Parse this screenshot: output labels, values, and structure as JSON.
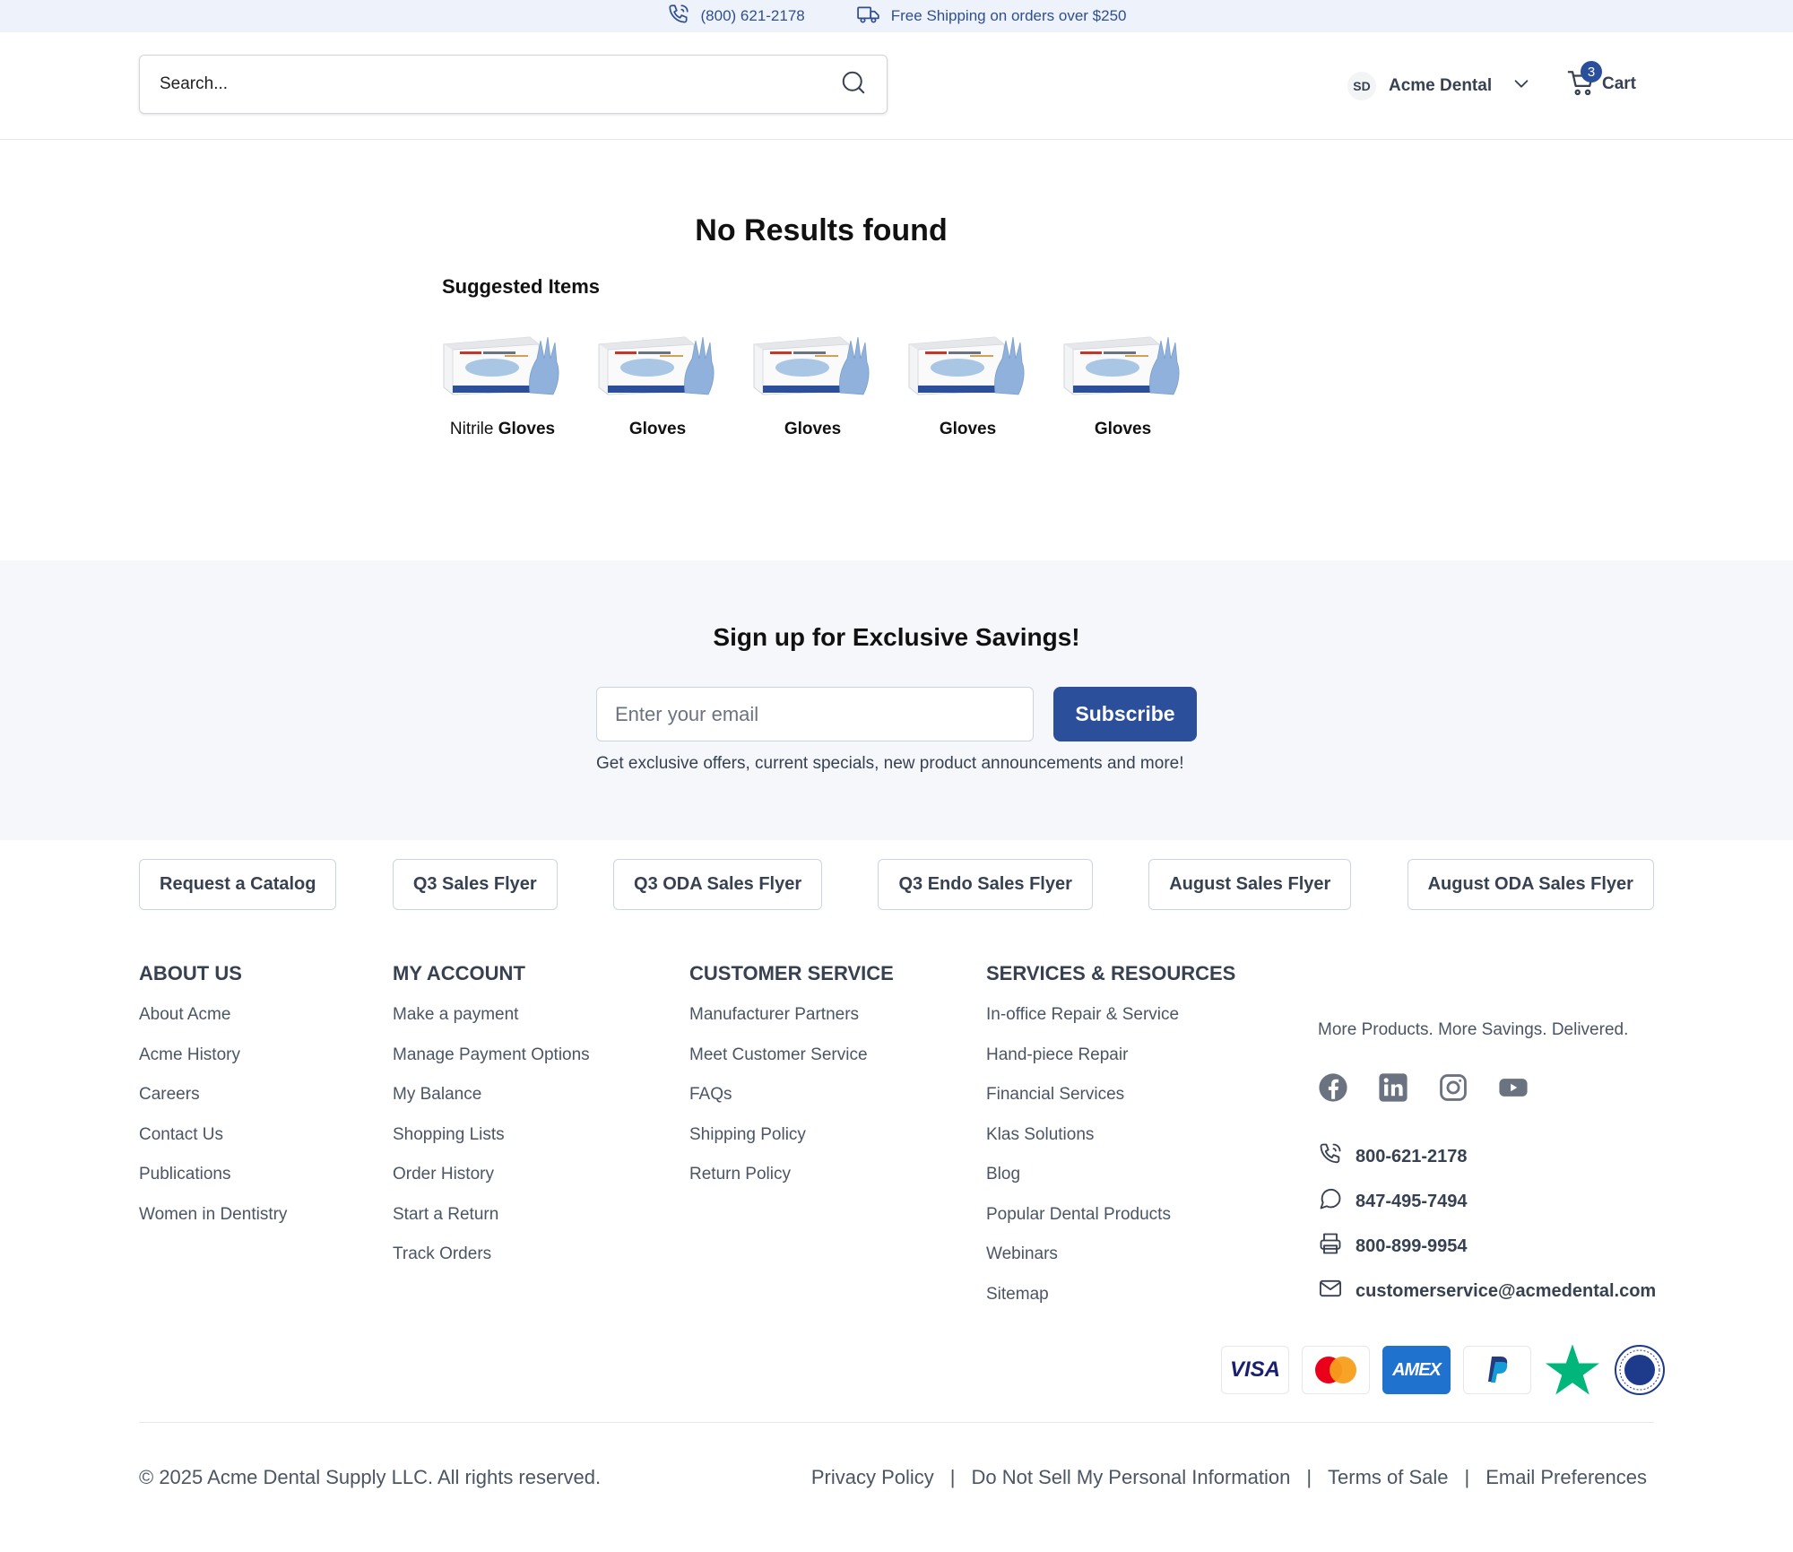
{
  "topbar": {
    "phone": "(800) 621-2178",
    "shipping": "Free Shipping on orders over $250"
  },
  "header": {
    "search_placeholder": "Search...",
    "account_initials": "SD",
    "account_name": "Acme Dental",
    "cart_label": "Cart",
    "cart_count": "3"
  },
  "results": {
    "title": "No Results found",
    "suggested_label": "Suggested Items",
    "products": [
      {
        "prefix": "Nitrile ",
        "bold": "Gloves"
      },
      {
        "prefix": "",
        "bold": "Gloves"
      },
      {
        "prefix": "",
        "bold": "Gloves"
      },
      {
        "prefix": "",
        "bold": "Gloves"
      },
      {
        "prefix": "",
        "bold": "Gloves"
      }
    ]
  },
  "signup": {
    "title": "Sign up for Exclusive Savings!",
    "email_placeholder": "Enter your email",
    "button": "Subscribe",
    "note": "Get exclusive offers, current specials, new product announcements and more!"
  },
  "flyers": [
    "Request a Catalog",
    "Q3 Sales Flyer",
    "Q3 ODA Sales Flyer",
    "Q3 Endo Sales Flyer",
    "August Sales Flyer",
    "August ODA Sales Flyer"
  ],
  "footer": {
    "about": {
      "title": "ABOUT US",
      "links": [
        "About Acme",
        "Acme History",
        "Careers",
        "Contact Us",
        "Publications",
        "Women in Dentistry"
      ]
    },
    "account": {
      "title": "MY ACCOUNT",
      "links": [
        "Make a payment",
        "Manage Payment Options",
        "My Balance",
        "Shopping Lists",
        "Order History",
        "Start a Return",
        "Track Orders"
      ]
    },
    "service": {
      "title": "CUSTOMER SERVICE",
      "links": [
        "Manufacturer Partners",
        "Meet Customer Service",
        "FAQs",
        "Shipping Policy",
        "Return Policy"
      ]
    },
    "resources": {
      "title": "SERVICES & RESOURCES",
      "links": [
        "In-office Repair & Service",
        "Hand-piece Repair",
        "Financial Services",
        "Klas Solutions",
        "Blog",
        "Popular Dental Products",
        "Webinars",
        "Sitemap"
      ]
    },
    "tagline": "More Products. More Savings. Delivered.",
    "phone": "800-621-2178",
    "chat": "847-495-7494",
    "fax": "800-899-9954",
    "email": "customerservice@acmedental.com",
    "payment_icons": [
      "visa",
      "mastercard",
      "amex",
      "paypal"
    ],
    "visa_text": "VISA",
    "amex_text": "AMEX",
    "copyright": "© 2025 Acme Dental Supply LLC. All rights reserved.",
    "legal": [
      "Privacy Policy",
      "Do Not Sell My Personal Information",
      "Terms of Sale",
      "Email Preferences"
    ],
    "separator": "|"
  },
  "colors": {
    "brand": "#2c4f9c",
    "topbar_bg": "#eef2fa",
    "section_bg": "#f5f7fa"
  }
}
